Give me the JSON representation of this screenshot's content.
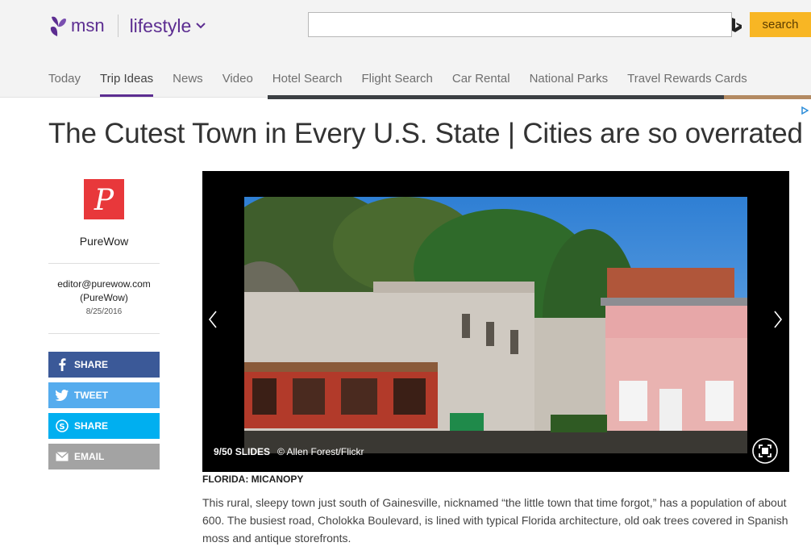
{
  "header": {
    "brand": "msn",
    "channel": "lifestyle",
    "search_placeholder": "",
    "search_button": "search"
  },
  "nav": {
    "items": [
      {
        "label": "Today"
      },
      {
        "label": "Trip Ideas",
        "active": true
      },
      {
        "label": "News"
      },
      {
        "label": "Video"
      },
      {
        "label": "Hotel Search"
      },
      {
        "label": "Flight Search"
      },
      {
        "label": "Car Rental"
      },
      {
        "label": "National Parks"
      },
      {
        "label": "Travel Rewards Cards"
      }
    ]
  },
  "article": {
    "title": "The Cutest Town in Every U.S. State | Cities are so overrated"
  },
  "author": {
    "logo_letter": "P",
    "name": "PureWow",
    "email": "editor@purewow.com",
    "org": "(PureWow)",
    "date": "8/25/2016"
  },
  "share": {
    "facebook": "SHARE",
    "twitter": "TWEET",
    "skype": "SHARE",
    "email": "EMAIL"
  },
  "slideshow": {
    "count": "9/50 SLIDES",
    "credit": "© Allen Forest/Flickr"
  },
  "caption": {
    "title": "FLORIDA: MICANOPY",
    "body": "This rural, sleepy town just south of Gainesville, nicknamed “the little town that time forgot,” has a population of about 600. The busiest road, Cholokka Boulevard, is lined with typical Florida architecture, old oak trees covered in Spanish moss and antique storefronts."
  },
  "colors": {
    "brand_purple": "#5c2d91",
    "search_button": "#f8b624",
    "facebook": "#3b5998",
    "twitter": "#55acee",
    "skype": "#00aff0",
    "email": "#a3a3a3",
    "author_logo": "#e8383b"
  },
  "icons": [
    "msn-butterfly-icon",
    "chevron-down-icon",
    "bing-icon",
    "adchoices-icon",
    "facebook-icon",
    "twitter-icon",
    "skype-icon",
    "email-icon",
    "prev-arrow-icon",
    "next-arrow-icon",
    "expand-icon"
  ]
}
